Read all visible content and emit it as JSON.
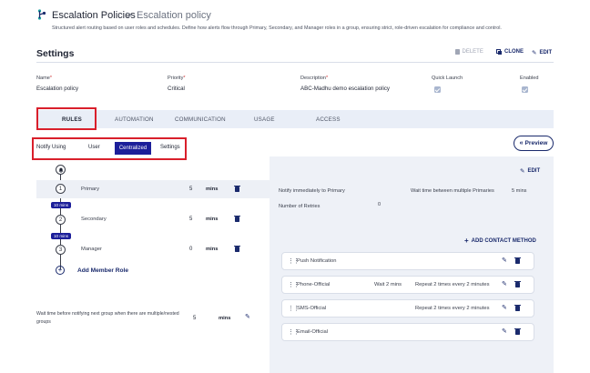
{
  "header": {
    "title": "Escalation Policies",
    "breadcrumb_sep": ">",
    "breadcrumb_current": "Escalation policy",
    "description": "Structured alert routing based on user roles and schedules. Define how alerts flow through Primary, Secondary, and Manager roles in a group, ensuring strict, role-driven escalation for compliance and control."
  },
  "settings": {
    "title": "Settings",
    "actions": {
      "delete": "DELETE",
      "clone": "CLONE",
      "edit": "EDIT"
    },
    "fields": {
      "name_label": "Name",
      "name_value": "Escalation policy",
      "priority_label": "Priority",
      "priority_value": "Critical",
      "description_label": "Description",
      "description_value": "ABC-Madhu demo escalation policy",
      "quick_launch_label": "Quick Launch",
      "quick_launch_checked": true,
      "enabled_label": "Enabled",
      "enabled_checked": true,
      "required_mark": "*"
    }
  },
  "tabs": [
    {
      "label": "RULES",
      "active": true
    },
    {
      "label": "AUTOMATION",
      "active": false
    },
    {
      "label": "COMMUNICATION",
      "active": false
    },
    {
      "label": "USAGE",
      "active": false
    },
    {
      "label": "ACCESS",
      "active": false
    }
  ],
  "notify": {
    "label": "Notify Using",
    "options": [
      "User",
      "Centralized",
      "Settings"
    ],
    "selected": "Centralized",
    "preview_label": "Preview"
  },
  "members": [
    {
      "index": "1",
      "role": "Primary",
      "wait": "5",
      "unit": "mins"
    },
    {
      "index": "2",
      "role": "Secondary",
      "wait": "5",
      "unit": "mins"
    },
    {
      "index": "3",
      "role": "Manager",
      "wait": "0",
      "unit": "mins"
    }
  ],
  "gaps": [
    "10 mins",
    "10 mins"
  ],
  "add_member_label": "Add Member Role",
  "group_wait": {
    "label": "Wait time before notifying next group when there are multiple/nested groups",
    "value": "5",
    "unit": "mins"
  },
  "detail": {
    "edit_label": "EDIT",
    "notify_text": "Notify immediately to Primary",
    "wait_between_label": "Wait time between multiple Primaries",
    "wait_between_value": "5 mins",
    "retries_label": "Number of Retries",
    "retries_value": "0",
    "add_contact_label": "ADD CONTACT METHOD",
    "contact_methods": [
      {
        "name": "Push Notification",
        "wait": "",
        "repeat": ""
      },
      {
        "name": "Phone-Official",
        "wait": "Wait 2 mins",
        "repeat": "Repeat 2 times every 2 minutes"
      },
      {
        "name": "SMS-Official",
        "wait": "",
        "repeat": "Repeat 2 times every 2 minutes"
      },
      {
        "name": "Email-Official",
        "wait": "",
        "repeat": ""
      }
    ]
  },
  "colors": {
    "accent": "#1a2a6c",
    "segment_active": "#1c1f9a",
    "highlight": "#d91f2b",
    "panel": "#eef1f7"
  }
}
